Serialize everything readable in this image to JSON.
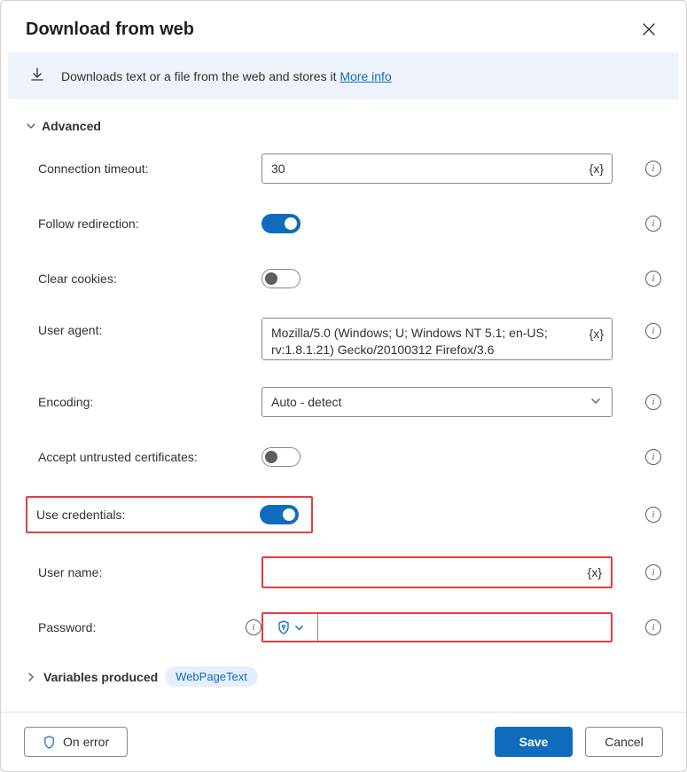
{
  "dialog": {
    "title": "Download from web"
  },
  "banner": {
    "text": "Downloads text or a file from the web and stores it ",
    "more_info": "More info"
  },
  "sections": {
    "advanced_label": "Advanced",
    "variables_label": "Variables produced",
    "variable_badge": "WebPageText"
  },
  "fields": {
    "connection_timeout": {
      "label": "Connection timeout:",
      "value": "30"
    },
    "follow_redirection": {
      "label": "Follow redirection:",
      "on": true
    },
    "clear_cookies": {
      "label": "Clear cookies:",
      "on": false
    },
    "user_agent": {
      "label": "User agent:",
      "value": "Mozilla/5.0 (Windows; U; Windows NT 5.1; en-US; rv:1.8.1.21) Gecko/20100312 Firefox/3.6"
    },
    "encoding": {
      "label": "Encoding:",
      "value": "Auto - detect"
    },
    "accept_untrusted": {
      "label": "Accept untrusted certificates:",
      "on": false
    },
    "use_credentials": {
      "label": "Use credentials:",
      "on": true
    },
    "username": {
      "label": "User name:",
      "value": ""
    },
    "password": {
      "label": "Password:",
      "value": ""
    }
  },
  "var_token": "{x}",
  "footer": {
    "on_error": "On error",
    "save": "Save",
    "cancel": "Cancel"
  }
}
